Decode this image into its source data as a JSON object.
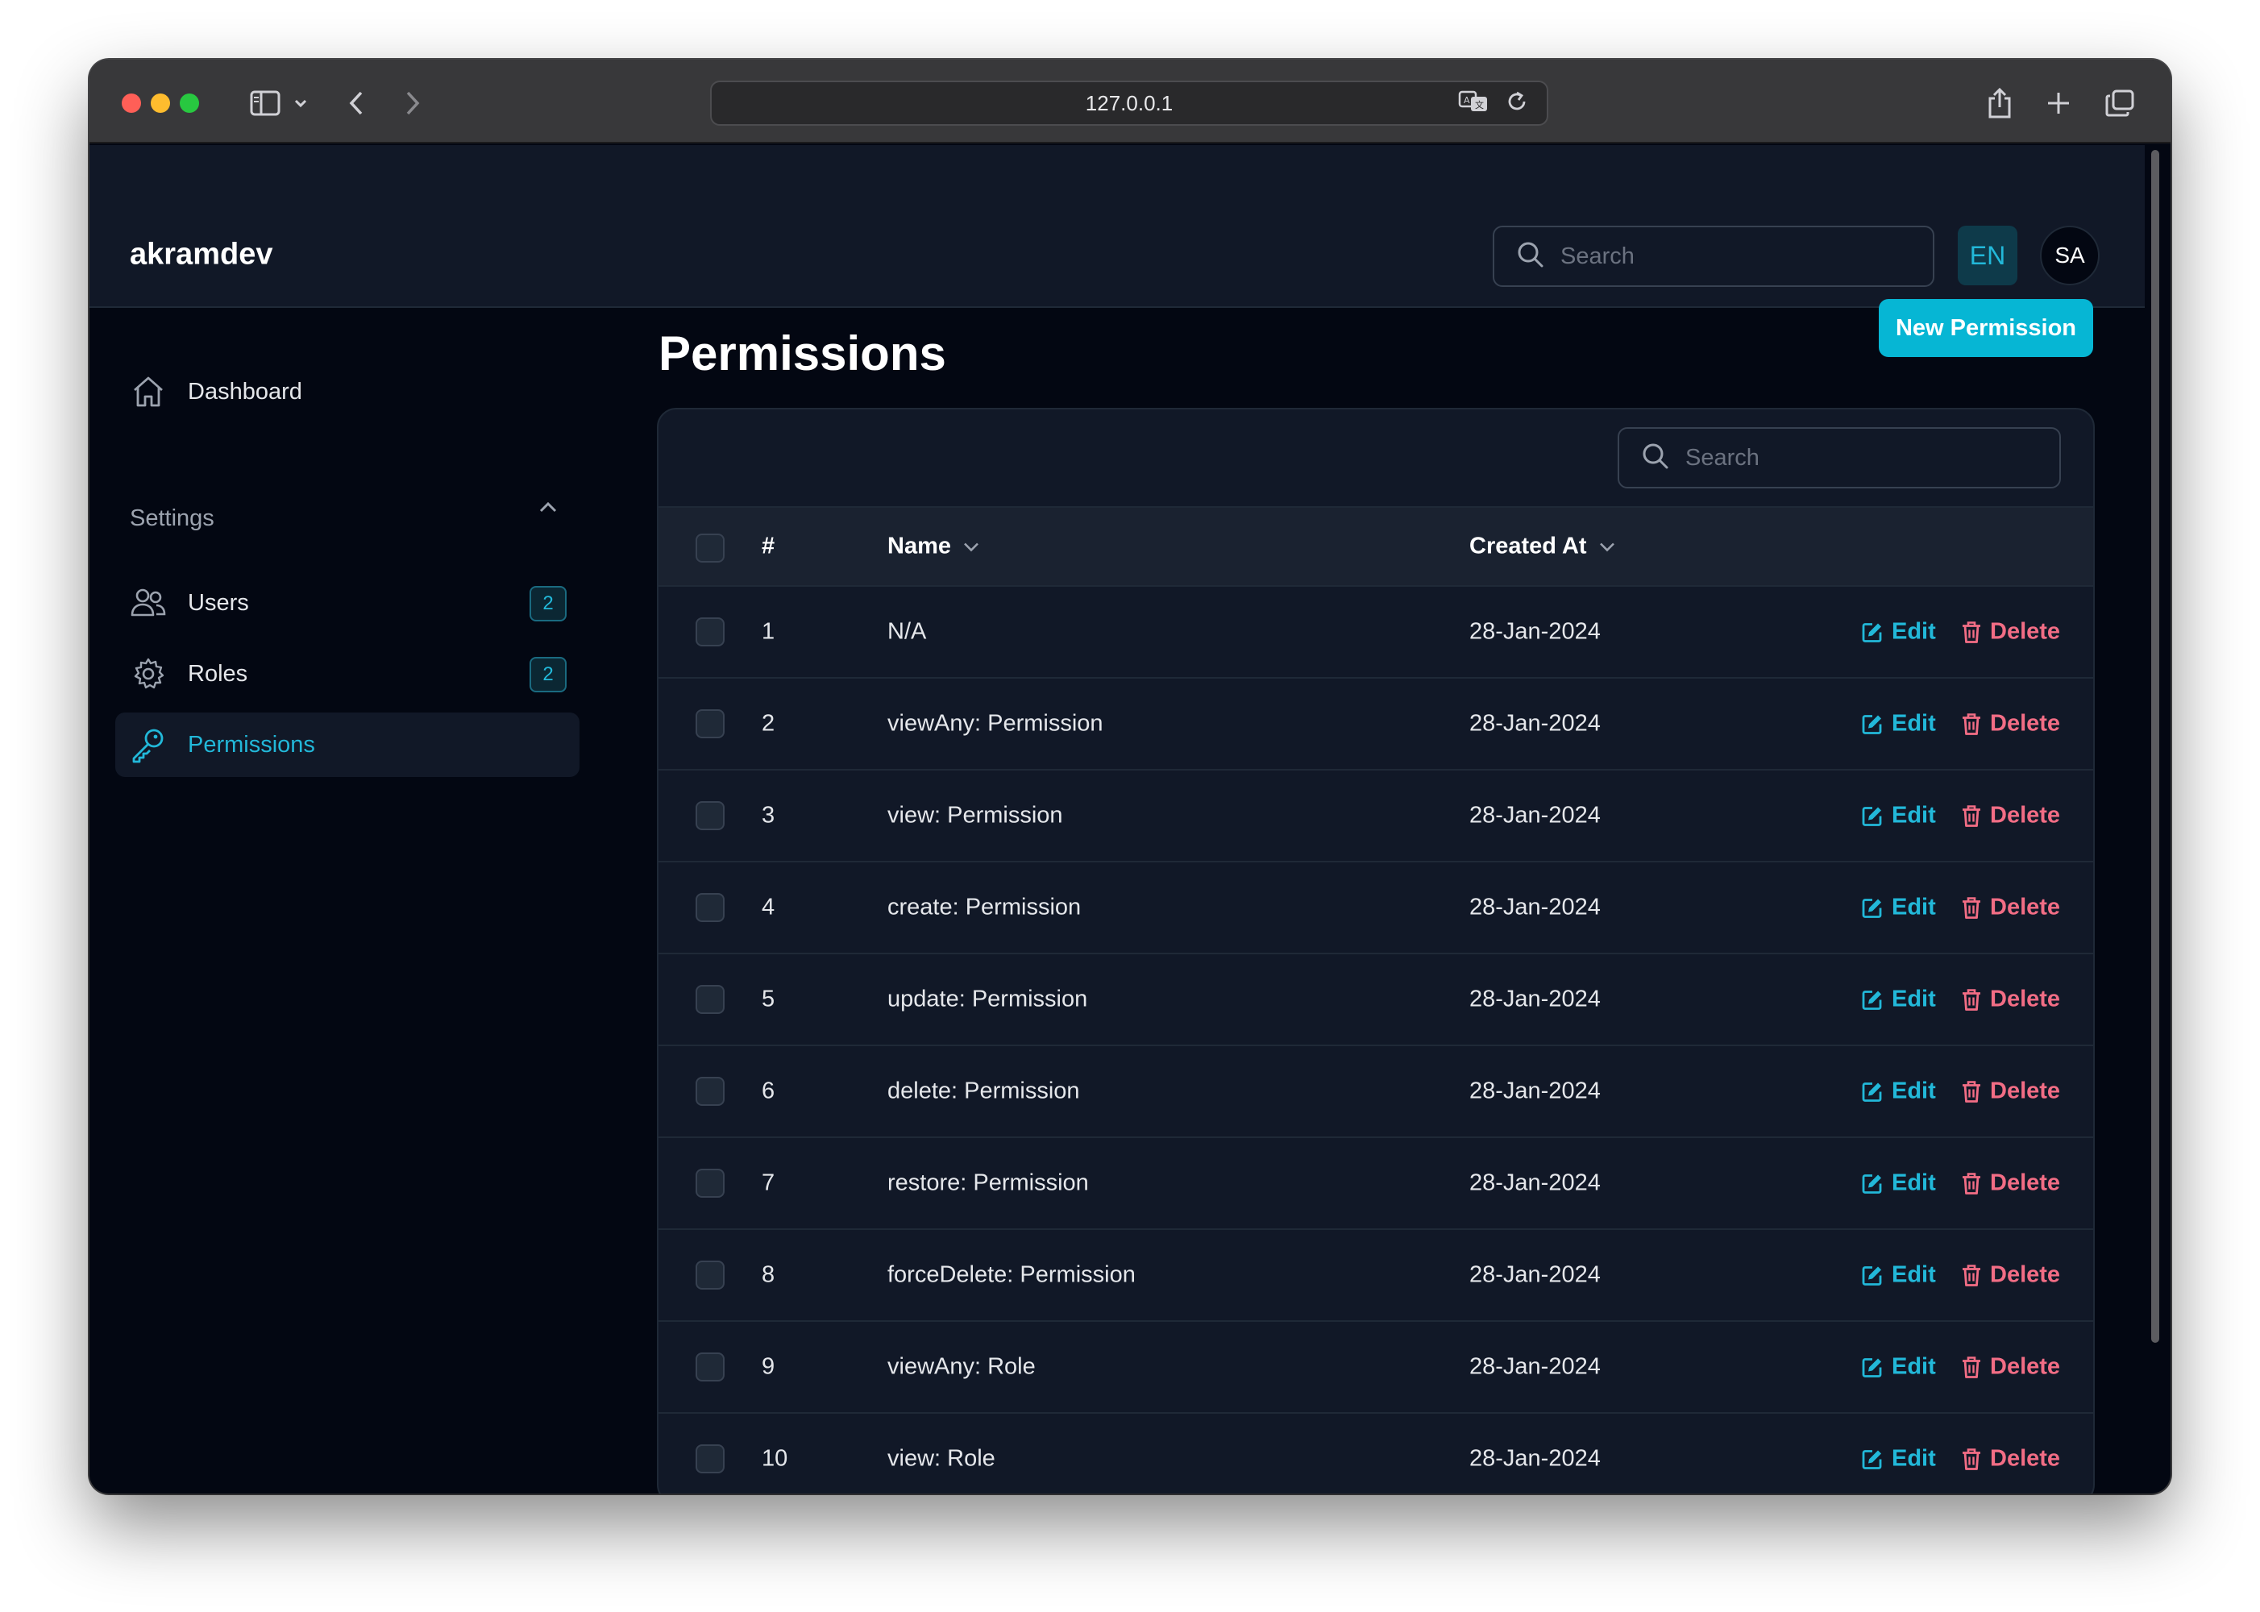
{
  "browser": {
    "url": "127.0.0.1",
    "icons": [
      "sidebar-toggle-icon",
      "chevron-down-icon",
      "back-icon",
      "forward-icon",
      "translate-icon",
      "reload-icon",
      "share-icon",
      "new-tab-icon",
      "tabs-overview-icon"
    ]
  },
  "header": {
    "brand": "akramdev",
    "search_placeholder": "Search",
    "language": "EN",
    "avatar_initials": "SA"
  },
  "sidebar": {
    "dashboard_label": "Dashboard",
    "settings_group": "Settings",
    "items": [
      {
        "label": "Users",
        "badge": "2",
        "icon": "users-icon"
      },
      {
        "label": "Roles",
        "badge": "2",
        "icon": "gear-icon"
      },
      {
        "label": "Permissions",
        "icon": "key-icon",
        "active": true
      }
    ]
  },
  "page": {
    "title": "Permissions",
    "new_button": "New Permission"
  },
  "table": {
    "search_placeholder": "Search",
    "columns": {
      "index": "#",
      "name": "Name",
      "created_at": "Created At"
    },
    "edit_label": "Edit",
    "delete_label": "Delete",
    "rows": [
      {
        "index": "1",
        "name": "N/A",
        "created_at": "28-Jan-2024"
      },
      {
        "index": "2",
        "name": "viewAny: Permission",
        "created_at": "28-Jan-2024"
      },
      {
        "index": "3",
        "name": "view: Permission",
        "created_at": "28-Jan-2024"
      },
      {
        "index": "4",
        "name": "create: Permission",
        "created_at": "28-Jan-2024"
      },
      {
        "index": "5",
        "name": "update: Permission",
        "created_at": "28-Jan-2024"
      },
      {
        "index": "6",
        "name": "delete: Permission",
        "created_at": "28-Jan-2024"
      },
      {
        "index": "7",
        "name": "restore: Permission",
        "created_at": "28-Jan-2024"
      },
      {
        "index": "8",
        "name": "forceDelete: Permission",
        "created_at": "28-Jan-2024"
      },
      {
        "index": "9",
        "name": "viewAny: Role",
        "created_at": "28-Jan-2024"
      },
      {
        "index": "10",
        "name": "view: Role",
        "created_at": "28-Jan-2024"
      }
    ]
  },
  "colors": {
    "accent": "#06b6d4",
    "accent_text": "#22b8d9",
    "danger": "#f26d85",
    "background": "#030712",
    "surface": "#111827"
  }
}
